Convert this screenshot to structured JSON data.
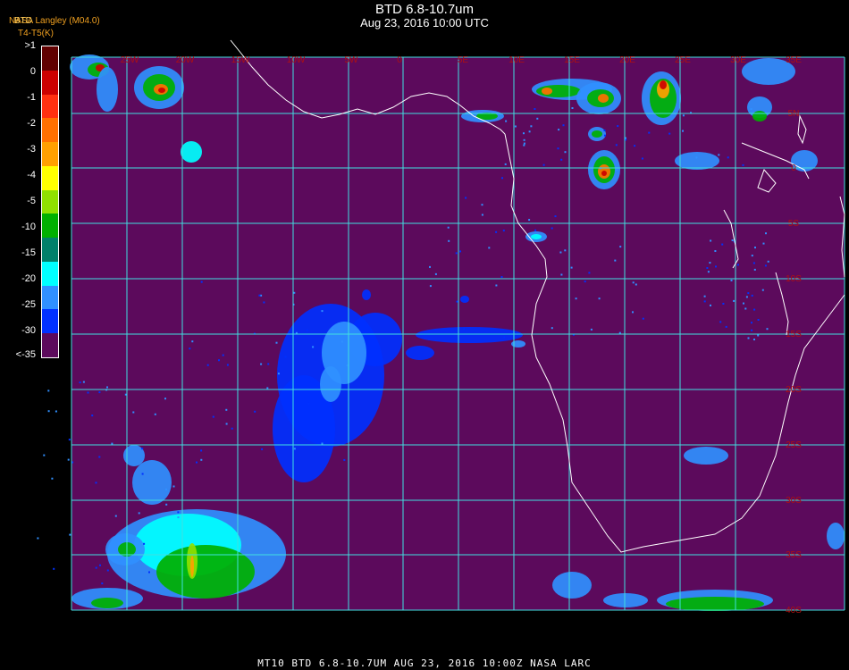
{
  "header": {
    "title": "BTD 6.8-10.7um",
    "subtitle": "Aug 23, 2016 10:00 UTC",
    "credit_line1": "NASA Langley (M04.0)",
    "credit_line2": "T4-T5(K)",
    "credit_overlap": "BTD"
  },
  "colorbar": {
    "labels": [
      ">1",
      "0",
      "-1",
      "-2",
      "-3",
      "-4",
      "-5",
      "-10",
      "-15",
      "-20",
      "-25",
      "-30",
      "<-35"
    ],
    "colors": [
      "#600000",
      "#cc0000",
      "#ff3010",
      "#ff7000",
      "#ffa000",
      "#ffff00",
      "#90e000",
      "#00b000",
      "#00806a",
      "#00ffff",
      "#3090ff",
      "#0030ff",
      "#5c0a5c"
    ]
  },
  "map": {
    "background_color": "#5c0a5c",
    "grid_color": "#40e0e0",
    "coast_color": "#ffffff",
    "label_color": "#b01010",
    "top_labels": [
      "25W",
      "20W",
      "15W",
      "10W",
      "5W",
      "0",
      "5E",
      "10E",
      "15E",
      "20E",
      "25E",
      "30E",
      "35E"
    ],
    "right_labels": [
      "5N",
      "0",
      "5S",
      "10S",
      "15S",
      "20S",
      "25S",
      "30S",
      "35S",
      "40S"
    ]
  },
  "footer": {
    "text": "MT10  BTD 6.8-10.7UM   AUG 23, 2016 10:00Z   NASA LARC"
  }
}
